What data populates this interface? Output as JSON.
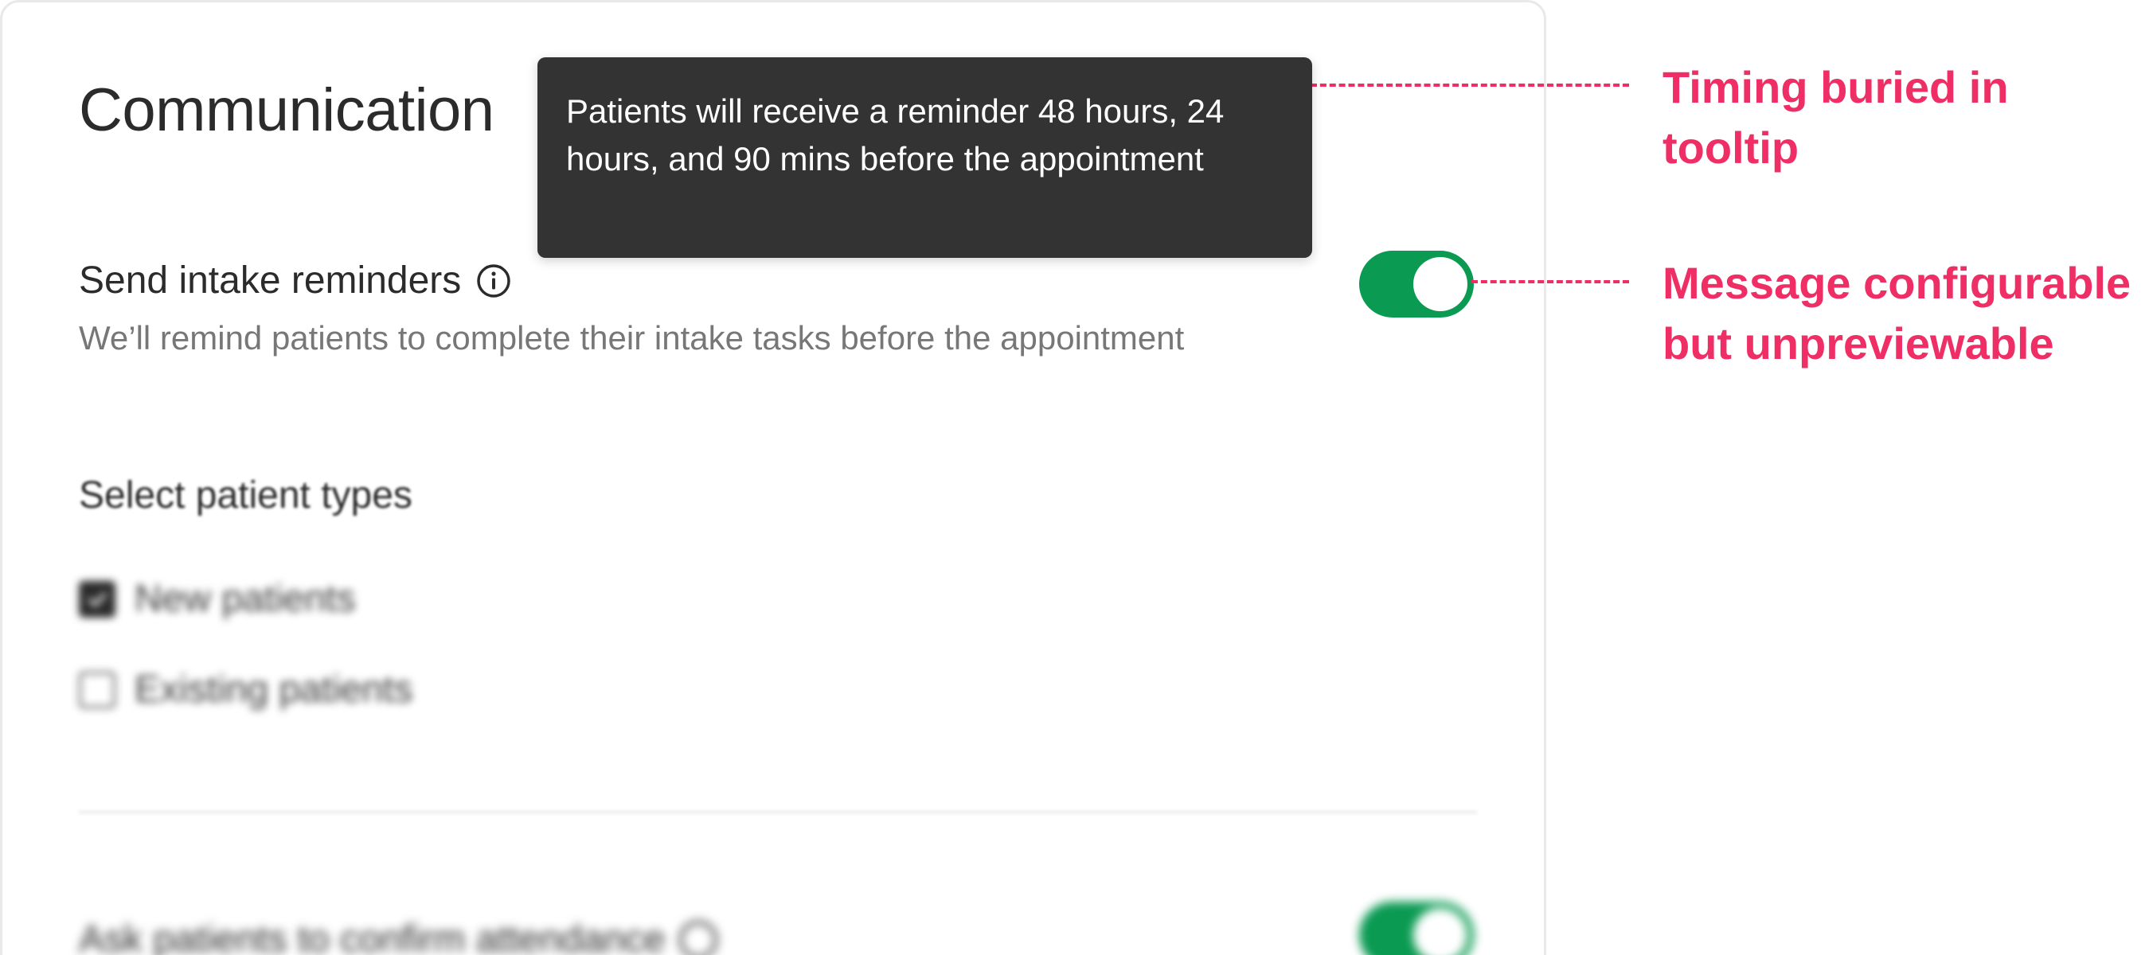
{
  "page": {
    "title": "Communication"
  },
  "tooltip": {
    "text": "Patients will receive a reminder 48 hours, 24 hours, and 90 mins before the appointment"
  },
  "intake_setting": {
    "label": "Send intake reminders",
    "description": "We’ll remind patients to complete their intake tasks before the appointment",
    "enabled": true,
    "info_icon": "info-icon"
  },
  "patient_types": {
    "heading": "Select patient types",
    "options": [
      {
        "label": "New patients",
        "checked": true
      },
      {
        "label": "Existing patients",
        "checked": false
      }
    ]
  },
  "confirm_setting": {
    "label": "Ask patients to confirm attendance",
    "enabled": true
  },
  "annotations": {
    "color": "#ee2e64",
    "callouts": [
      {
        "line1": "Timing buried in",
        "line2": "tooltip"
      },
      {
        "line1": "Message configurable",
        "line2": "but unpreviewable"
      }
    ]
  },
  "colors": {
    "toggle_on": "#0a9a52",
    "tooltip_bg": "#333333",
    "annotation": "#ee2e64"
  }
}
